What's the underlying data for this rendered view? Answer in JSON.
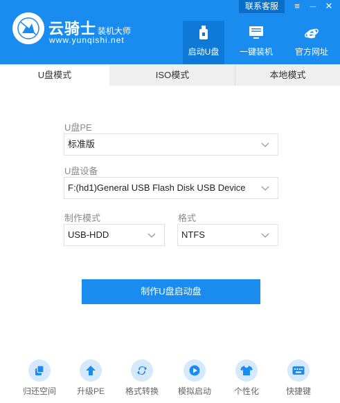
{
  "header": {
    "brand_name": "云骑士",
    "brand_sub": "装机大师",
    "brand_url": "www.yunqishi.net",
    "contact_label": "联系客服",
    "menu_glyph": "≡",
    "minimize_glyph": "—",
    "close_glyph": "✕",
    "nav": [
      {
        "label": "启动U盘",
        "icon": "usb-drive-icon",
        "active": true
      },
      {
        "label": "一键装机",
        "icon": "monitor-icon",
        "active": false
      },
      {
        "label": "官方网址",
        "icon": "ie-browser-icon",
        "active": false
      }
    ]
  },
  "tabs": [
    {
      "label": "U盘模式",
      "active": true
    },
    {
      "label": "ISO模式",
      "active": false
    },
    {
      "label": "本地模式",
      "active": false
    }
  ],
  "form": {
    "pe_label": "U盘PE",
    "pe_value": "标准版",
    "device_label": "U盘设备",
    "device_value": "F:(hd1)General USB Flash Disk USB Device",
    "mode_label": "制作模式",
    "mode_value": "USB-HDD",
    "format_label": "格式",
    "format_value": "NTFS"
  },
  "make_button_label": "制作U盘启动盘",
  "tools": [
    {
      "label": "归还空间",
      "icon": "restore-space-icon"
    },
    {
      "label": "升级PE",
      "icon": "upgrade-icon"
    },
    {
      "label": "格式转换",
      "icon": "convert-icon"
    },
    {
      "label": "模拟启动",
      "icon": "play-icon"
    },
    {
      "label": "个性化",
      "icon": "tshirt-icon"
    },
    {
      "label": "快捷键",
      "icon": "keyboard-icon"
    }
  ],
  "colors": {
    "primary": "#1a8cf0",
    "header_dark": "#0b6ec7",
    "tool_bg": "#d6e8fb"
  }
}
